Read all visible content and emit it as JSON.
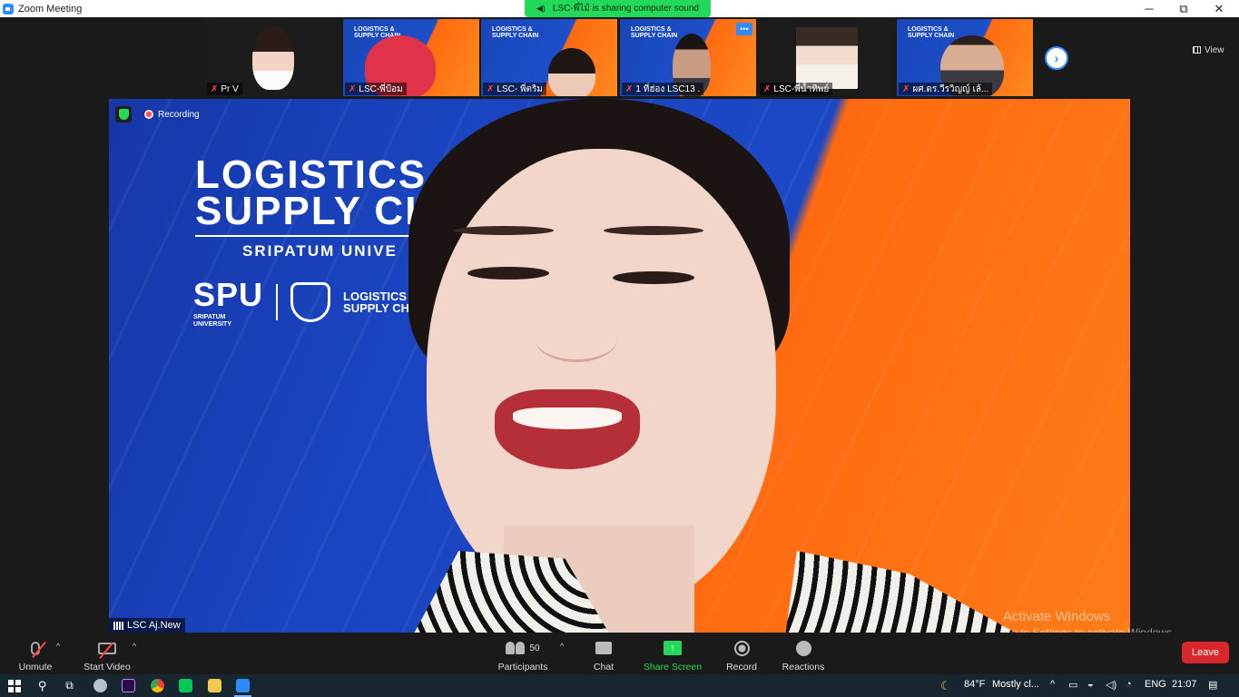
{
  "window": {
    "title": "Zoom Meeting",
    "controls": {
      "minimize": "─",
      "restore": "⧉",
      "close": "✕"
    }
  },
  "share_banner": {
    "text": "LSC-พี่ไม้ is sharing computer sound"
  },
  "view_button": {
    "label": "View"
  },
  "thumbnails": [
    {
      "name": "Pr V",
      "muted": true,
      "background": "plain"
    },
    {
      "name": "LSC-พี่ป้อม",
      "muted": true,
      "background": "brand"
    },
    {
      "name": "LSC- พี่ตริม",
      "muted": true,
      "background": "brand"
    },
    {
      "name": "1 ที่ฮ่อง LSC13 .",
      "muted": true,
      "background": "brand",
      "has_more_button": true
    },
    {
      "name": "LSC-พี่น้ำทิพย์",
      "muted": true,
      "background": "plain"
    },
    {
      "name": "ผศ.ดร.วีรวิญญ์ เล้...",
      "muted": true,
      "background": "brand"
    }
  ],
  "thumb_brand_text": [
    "LOGISTICS &",
    "SUPPLY CHAIN"
  ],
  "main_video": {
    "speaker_name": "LSC Aj.New",
    "recording_label": "Recording",
    "brand_line1": "LOGISTICS",
    "brand_line2": "SUPPLY CH",
    "brand_line3": "SRIPATUM UNIVE",
    "spu_logo": "SPU",
    "spu_sub": "SRIPATUM UNIVERSITY",
    "lsc_text_1": "LOGISTICS",
    "lsc_text_2": "SUPPLY CH"
  },
  "watermark": {
    "line1": "Activate Windows",
    "line2": "Go to Settings to activate Windows."
  },
  "toolbar": {
    "unmute": "Unmute",
    "start_video": "Start Video",
    "participants": "Participants",
    "participants_count": "50",
    "chat": "Chat",
    "share_screen": "Share Screen",
    "record": "Record",
    "reactions": "Reactions",
    "leave": "Leave"
  },
  "taskbar": {
    "weather_temp": "84°F",
    "weather_text": "Mostly cl...",
    "language": "ENG",
    "time": "21:07"
  },
  "colors": {
    "zoom_blue": "#2d8cff",
    "share_green": "#23d959",
    "leave_red": "#d9282b",
    "brand_blue": "#1a44c0",
    "brand_orange": "#ff7b18"
  },
  "icons": [
    "zoom-app-icon",
    "speaker-icon",
    "mic-off-icon",
    "camera-off-icon",
    "participants-icon",
    "chat-icon",
    "share-screen-icon",
    "record-icon",
    "reactions-icon",
    "security-shield-icon",
    "recording-dot-icon",
    "signal-icon",
    "chevron-right-icon",
    "grid-view-icon",
    "windows-start-icon",
    "search-icon",
    "task-view-icon"
  ]
}
